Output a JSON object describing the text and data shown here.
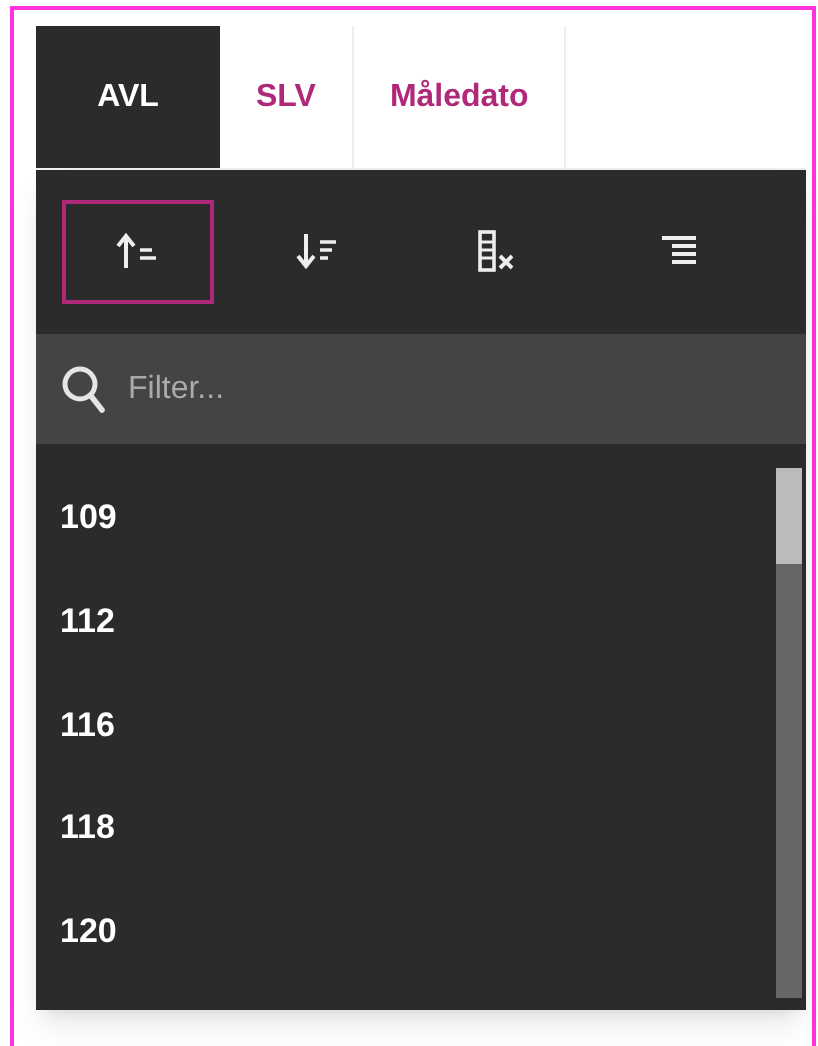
{
  "tabs": [
    {
      "label": "AVL",
      "selected": true
    },
    {
      "label": "SLV",
      "selected": false
    },
    {
      "label": "Måledato",
      "selected": false
    }
  ],
  "toolbar": [
    {
      "kind": "sort_asc",
      "selected": true
    },
    {
      "kind": "sort_desc",
      "selected": false
    },
    {
      "kind": "clear_filter",
      "selected": false
    },
    {
      "kind": "align",
      "selected": false
    }
  ],
  "filter": {
    "placeholder": "Filter..."
  },
  "values": [
    "109",
    "112",
    "116",
    "118",
    "120"
  ]
}
